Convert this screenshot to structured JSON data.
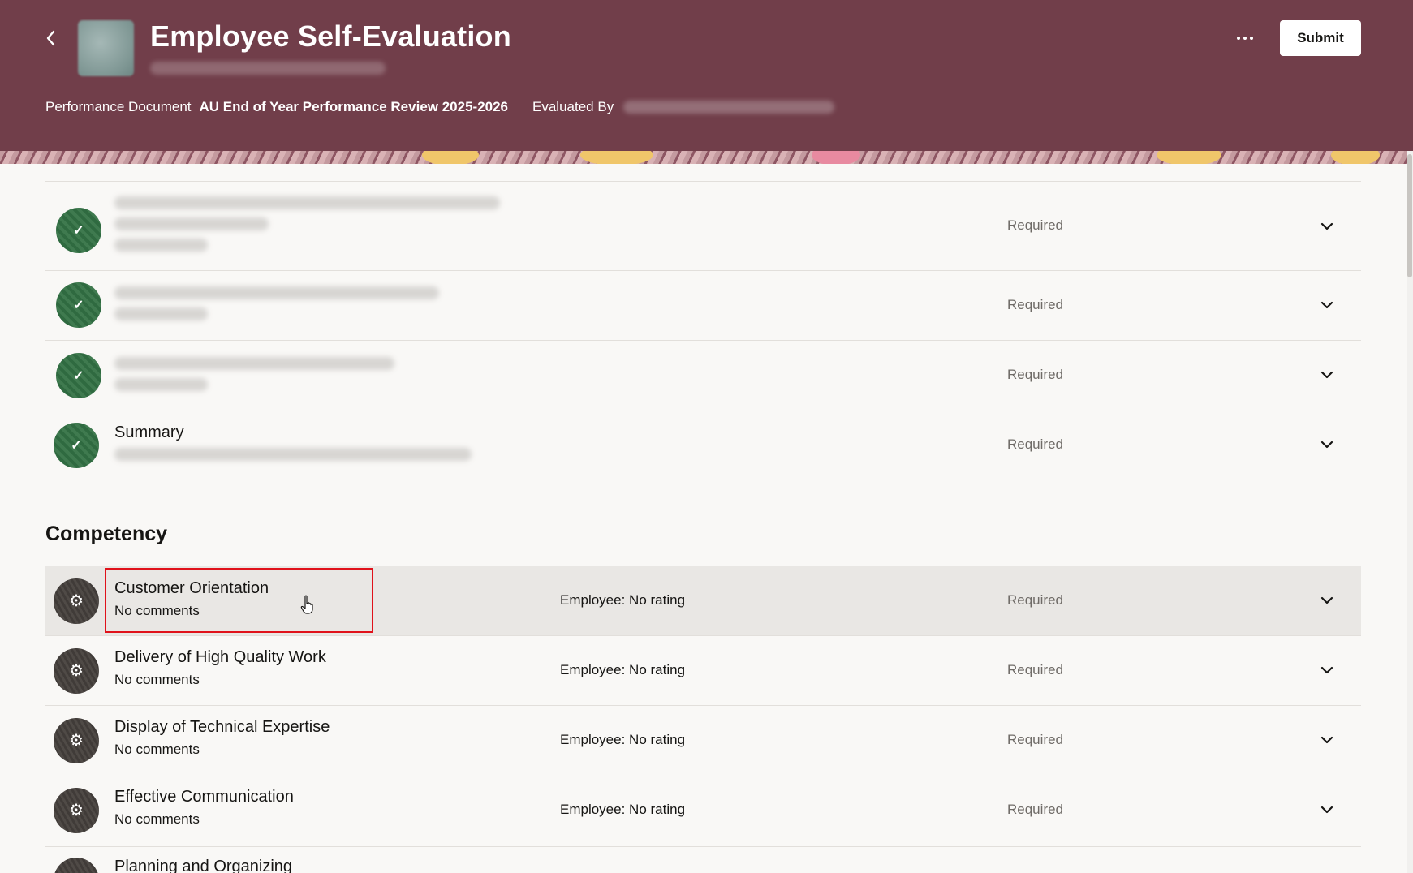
{
  "header": {
    "title": "Employee Self-Evaluation",
    "performance_document_label": "Performance Document",
    "performance_document_value": "AU End of Year Performance Review 2025-2026",
    "evaluated_by_label": "Evaluated By",
    "submit_label": "Submit"
  },
  "goals": [
    {
      "status": "Required"
    },
    {
      "status": "Required"
    },
    {
      "status": "Required"
    },
    {
      "title": "Summary",
      "status": "Required"
    }
  ],
  "competency": {
    "section_title": "Competency",
    "items": [
      {
        "title": "Customer Orientation",
        "comments": "No comments",
        "rating": "Employee: No rating",
        "status": "Required"
      },
      {
        "title": "Delivery of High Quality Work",
        "comments": "No comments",
        "rating": "Employee: No rating",
        "status": "Required"
      },
      {
        "title": "Display of Technical Expertise",
        "comments": "No comments",
        "rating": "Employee: No rating",
        "status": "Required"
      },
      {
        "title": "Effective Communication",
        "comments": "No comments",
        "rating": "Employee: No rating",
        "status": "Required"
      },
      {
        "title": "Planning and Organizing"
      }
    ]
  },
  "icons": {
    "back": "chevron-left-icon",
    "more": "more-horizontal-icon",
    "expand": "chevron-down-icon",
    "goal_status": "check-icon",
    "competency": "gear-icon"
  },
  "colors": {
    "header_bg": "#713e4a",
    "goal_icon": "#3f7a4f",
    "competency_icon": "#4f4a46",
    "highlight": "#e0121b"
  }
}
